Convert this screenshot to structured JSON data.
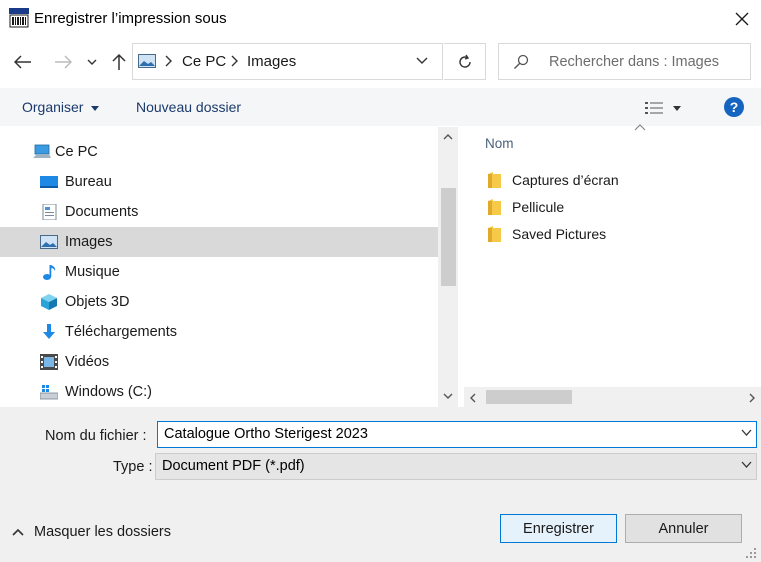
{
  "window": {
    "title": "Enregistrer l’impression sous"
  },
  "nav": {
    "address_segments": [
      "Ce PC",
      "Images"
    ],
    "search_placeholder": "Rechercher dans : Images"
  },
  "toolbar": {
    "organize_label": "Organiser",
    "new_folder_label": "Nouveau dossier",
    "help_label": "?"
  },
  "tree": {
    "root": "Ce PC",
    "items": [
      {
        "label": "Bureau",
        "icon": "desktop-icon"
      },
      {
        "label": "Documents",
        "icon": "documents-icon"
      },
      {
        "label": "Images",
        "icon": "pictures-icon",
        "selected": true
      },
      {
        "label": "Musique",
        "icon": "music-icon"
      },
      {
        "label": "Objets 3D",
        "icon": "3d-objects-icon"
      },
      {
        "label": "Téléchargements",
        "icon": "downloads-icon"
      },
      {
        "label": "Vidéos",
        "icon": "videos-icon"
      },
      {
        "label": "Windows (C:)",
        "icon": "drive-icon"
      }
    ]
  },
  "files": {
    "column_name": "Nom",
    "items": [
      {
        "label": "Captures d’écran"
      },
      {
        "label": "Pellicule"
      },
      {
        "label": "Saved Pictures"
      }
    ]
  },
  "form": {
    "filename_label": "Nom du fichier :",
    "filename_value": "Catalogue Ortho Sterigest 2023",
    "type_label": "Type :",
    "type_value": "Document PDF (*.pdf)"
  },
  "footer": {
    "hide_folders_label": "Masquer les dossiers",
    "save_label": "Enregistrer",
    "cancel_label": "Annuler"
  },
  "colors": {
    "accent": "#0078d7",
    "folder": "#f7c948",
    "selection": "#d9d9d9"
  }
}
